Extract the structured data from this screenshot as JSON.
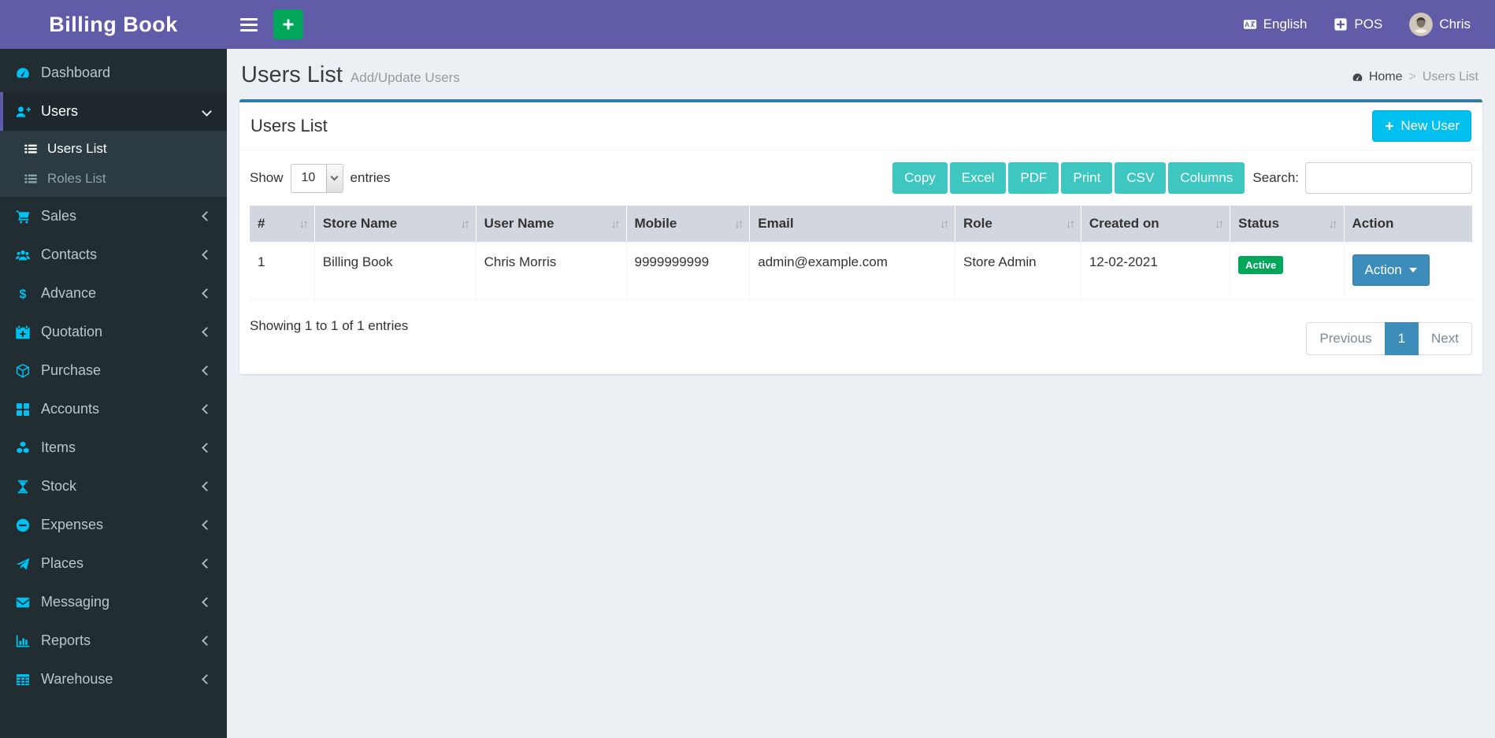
{
  "colors": {
    "navbar_bg": "#605ca8",
    "sidebar_bg": "#222d32",
    "submenu_bg": "#2c3b41",
    "sidebar_active_bg": "#1e282c",
    "content_bg": "#ecf0f5",
    "box_top_border": "#357ca5",
    "primary_blue": "#3c8dbc",
    "info_cyan": "#00c0ef",
    "success_green": "#00a65a",
    "export_teal": "#3ec6c0",
    "table_header_bg": "#d2d6de",
    "icon_cyan": "#00c0ef"
  },
  "navbar": {
    "brand": "Billing Book",
    "menu_toggle_icon": "hamburger-icon",
    "quick_add_icon": "plus-icon",
    "language": {
      "icon": "language-icon",
      "label": "English"
    },
    "pos": {
      "icon": "plus-square-icon",
      "label": "POS"
    },
    "user": {
      "avatar_icon": "avatar",
      "name": "Chris"
    }
  },
  "sidebar": {
    "items": [
      {
        "id": "dashboard",
        "icon": "dashboard-icon",
        "label": "Dashboard"
      },
      {
        "id": "users",
        "icon": "user-plus-icon",
        "label": "Users",
        "chevron": "down",
        "open": true,
        "children": [
          {
            "id": "users-list",
            "icon": "list-icon",
            "label": "Users List",
            "active": true
          },
          {
            "id": "roles-list",
            "icon": "list-icon",
            "label": "Roles List",
            "active": false
          }
        ]
      },
      {
        "id": "sales",
        "icon": "cart-icon",
        "label": "Sales",
        "chevron": "left"
      },
      {
        "id": "contacts",
        "icon": "people-icon",
        "label": "Contacts",
        "chevron": "left"
      },
      {
        "id": "advance",
        "icon": "dollar-icon",
        "label": "Advance",
        "chevron": "left"
      },
      {
        "id": "quotation",
        "icon": "calendar-plus-icon",
        "label": "Quotation",
        "chevron": "left"
      },
      {
        "id": "purchase",
        "icon": "cube-icon",
        "label": "Purchase",
        "chevron": "left"
      },
      {
        "id": "accounts",
        "icon": "grid-icon",
        "label": "Accounts",
        "chevron": "left"
      },
      {
        "id": "items",
        "icon": "cubes-icon",
        "label": "Items",
        "chevron": "left"
      },
      {
        "id": "stock",
        "icon": "hourglass-icon",
        "label": "Stock",
        "chevron": "left"
      },
      {
        "id": "expenses",
        "icon": "minus-circle-icon",
        "label": "Expenses",
        "chevron": "left"
      },
      {
        "id": "places",
        "icon": "paper-plane-icon",
        "label": "Places",
        "chevron": "left"
      },
      {
        "id": "messaging",
        "icon": "envelope-icon",
        "label": "Messaging",
        "chevron": "left"
      },
      {
        "id": "reports",
        "icon": "bar-chart-icon",
        "label": "Reports",
        "chevron": "left"
      },
      {
        "id": "warehouse",
        "icon": "table-icon",
        "label": "Warehouse",
        "chevron": "left"
      }
    ]
  },
  "content_header": {
    "title": "Users List",
    "subtitle": "Add/Update Users",
    "breadcrumb": {
      "home_icon": "dashboard-icon",
      "home": "Home",
      "separator": ">",
      "current": "Users List"
    }
  },
  "card": {
    "title": "Users List",
    "new_user": {
      "icon": "plus-icon",
      "label": "New User"
    },
    "length_menu": {
      "prefix": "Show",
      "selected": "10",
      "suffix": "entries"
    },
    "export_buttons": [
      "Copy",
      "Excel",
      "PDF",
      "Print",
      "CSV",
      "Columns"
    ],
    "search": {
      "label": "Search:",
      "value": ""
    },
    "table": {
      "sort_icon_glyph": "↓↑",
      "columns": [
        {
          "key": "id",
          "label": "#",
          "sortable": true,
          "width": "5.3%"
        },
        {
          "key": "store_name",
          "label": "Store Name",
          "sortable": true,
          "width": "13.2%"
        },
        {
          "key": "user_name",
          "label": "User Name",
          "sortable": true,
          "width": "12.3%"
        },
        {
          "key": "mobile",
          "label": "Mobile",
          "sortable": true,
          "width": "10.1%"
        },
        {
          "key": "email",
          "label": "Email",
          "sortable": true,
          "width": "16.8%"
        },
        {
          "key": "role",
          "label": "Role",
          "sortable": true,
          "width": "10.3%"
        },
        {
          "key": "created_on",
          "label": "Created on",
          "sortable": true,
          "width": "12.2%"
        },
        {
          "key": "status",
          "label": "Status",
          "sortable": true,
          "width": "9.3%"
        },
        {
          "key": "action",
          "label": "Action",
          "sortable": false,
          "width": "10.5%"
        }
      ],
      "rows": [
        {
          "id": "1",
          "store_name": "Billing Book",
          "user_name": "Chris Morris",
          "mobile": "9999999999",
          "email": "admin@example.com",
          "role": "Store Admin",
          "created_on": "12-02-2021",
          "status": "Active",
          "action_label": "Action"
        }
      ]
    },
    "info": "Showing 1 to 1 of 1 entries",
    "pagination": {
      "previous": "Previous",
      "pages": [
        {
          "label": "1",
          "active": true
        }
      ],
      "next": "Next"
    }
  }
}
